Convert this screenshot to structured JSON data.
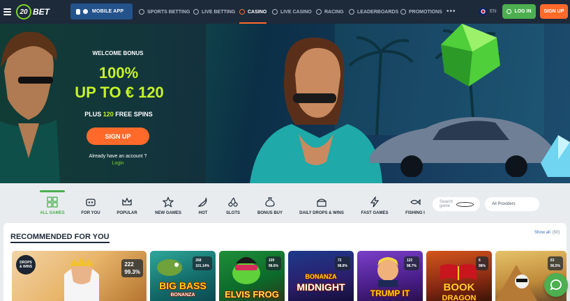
{
  "topnav": {
    "logo_number": "20",
    "logo_text": "BET",
    "mobile_app": "MOBILE APP",
    "links": [
      {
        "label": "SPORTS BETTING"
      },
      {
        "label": "LIVE BETTING"
      },
      {
        "label": "CASINO"
      },
      {
        "label": "LIVE CASINO"
      },
      {
        "label": "RACING"
      },
      {
        "label": "LEADERBOARDS"
      },
      {
        "label": "PROMOTIONS"
      }
    ],
    "more": "•••",
    "language": "EN",
    "login": "LOG IN",
    "signup": "SIGN UP",
    "accent_color": "#ff6a2b",
    "login_color": "#4caf50"
  },
  "hero": {
    "welcome": "WELCOME BONUS",
    "percent": "100%",
    "amount": "UP TO € 120",
    "spins_prefix": "PLUS ",
    "spins_count": "120",
    "spins_suffix": " FREE SPINS",
    "signup": "SIGN UP",
    "already": "Already have an account ?",
    "login": "Login"
  },
  "categories": [
    {
      "label": "ALL GAMES",
      "icon": "all-games-icon"
    },
    {
      "label": "FOR YOU",
      "icon": "for-you-icon"
    },
    {
      "label": "POPULAR",
      "icon": "crown-icon"
    },
    {
      "label": "NEW GAMES",
      "icon": "star-icon"
    },
    {
      "label": "HOT",
      "icon": "chili-icon"
    },
    {
      "label": "SLOTS",
      "icon": "cherries-icon"
    },
    {
      "label": "BONUS BUY",
      "icon": "money-bag-icon"
    },
    {
      "label": "DAILY DROPS & WINS",
      "icon": "treasure-icon"
    },
    {
      "label": "FAST GAMES",
      "icon": "lightning-icon"
    },
    {
      "label": "FISHING I",
      "icon": "fish-icon"
    }
  ],
  "search": {
    "placeholder": "Search game"
  },
  "providers": {
    "label": "All Providers"
  },
  "recommended": {
    "title": "RECOMMENDED FOR YOU",
    "show_all": "Show all",
    "show_all_count": "(50)",
    "games": [
      {
        "badge_line1": "DROPS",
        "badge_line2": "& WINS",
        "players": "222",
        "rtp": "99.3%"
      },
      {
        "name": "BIG BASS",
        "sub": "BONANZA",
        "players": "268",
        "rtp": "101.14%"
      },
      {
        "name": "ELVIS FROG",
        "players": "109",
        "rtp": "98.6%"
      },
      {
        "name": "BONANZA",
        "sub": "MIDNIGHT",
        "players": "72",
        "rtp": "98.8%"
      },
      {
        "name": "TRUMP IT",
        "players": "122",
        "rtp": "98.7%"
      },
      {
        "name": "BOOK",
        "sub": "DRAGON",
        "players": "6",
        "rtp": "98%"
      },
      {
        "players": "63",
        "rtp": "96.5%"
      }
    ]
  }
}
